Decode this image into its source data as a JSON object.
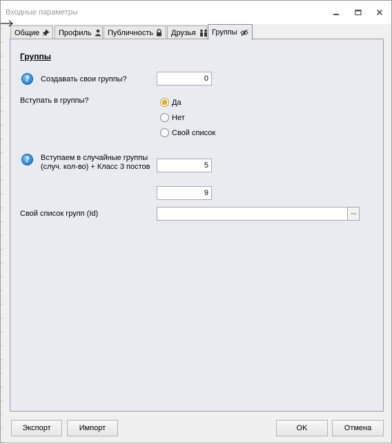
{
  "window": {
    "title": "Входные параметры",
    "minimize_icon": "minimize-icon",
    "maximize_icon": "restore-icon",
    "close_icon": "close-icon"
  },
  "tabs": [
    {
      "label": "Общие",
      "icon": "pin-icon"
    },
    {
      "label": "Профиль",
      "icon": "user-icon"
    },
    {
      "label": "Публичность",
      "icon": "lock-icon"
    },
    {
      "label": "Друзья",
      "icon": "people-icon"
    },
    {
      "label": "Группы",
      "icon": "eye-slash-icon",
      "active": true
    }
  ],
  "groups": {
    "section_title": "Группы",
    "create_label": "Создавать свои группы?",
    "create_value": "0",
    "join_label": "Вступать в группы?",
    "join_options": [
      {
        "label": "Да",
        "checked": true
      },
      {
        "label": "Нет",
        "checked": false
      },
      {
        "label": "Свой список",
        "checked": false
      }
    ],
    "random_label": "Вступаем в случайные группы (случ. кол-во) + Класс 3 постов",
    "random_value_1": "5",
    "random_value_2": "9",
    "custom_list_label": "Свой список групп (Id)",
    "custom_list_value": "",
    "browse_label": "···"
  },
  "footer": {
    "export_label": "Экспорт",
    "import_label": "Импорт",
    "ok_label": "OK",
    "cancel_label": "Отмена"
  },
  "colors": {
    "panel_bg": "#e8ecf1",
    "radio_checked": "#e2b53a",
    "help_icon": "#2a86d6"
  }
}
